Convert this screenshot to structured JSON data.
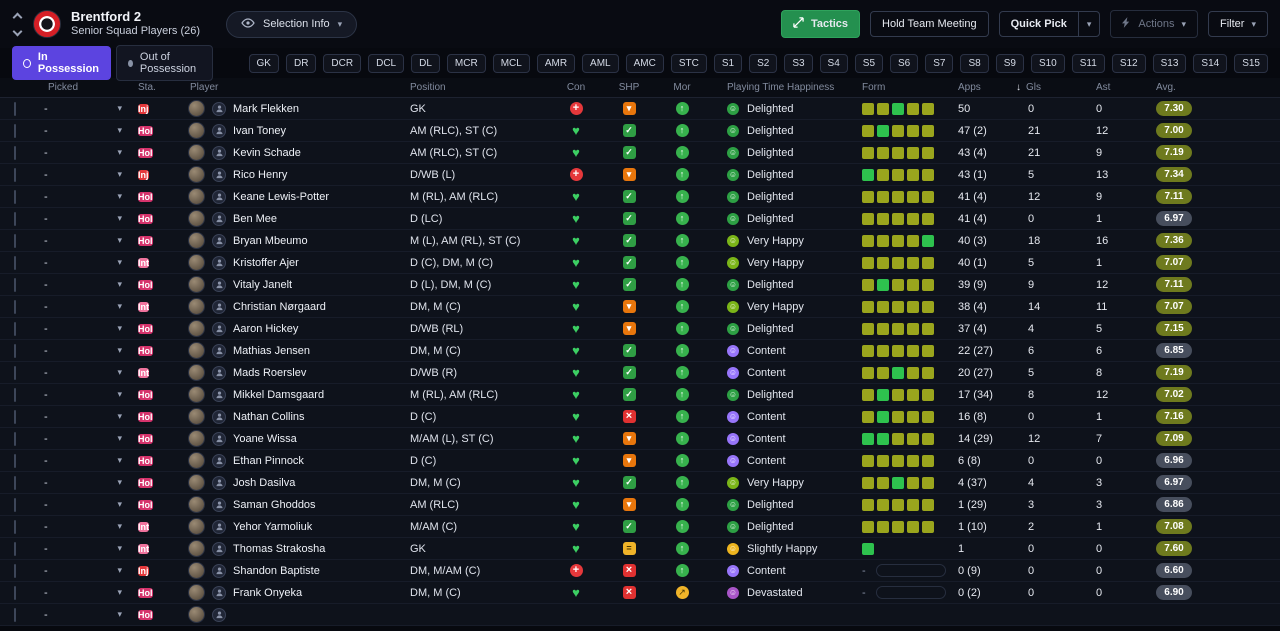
{
  "header": {
    "club": "Brentford 2",
    "subtitle": "Senior Squad Players (26)",
    "selection_info": "Selection Info",
    "tactics": "Tactics",
    "hold_team_meeting": "Hold Team Meeting",
    "quick_pick": "Quick Pick",
    "actions": "Actions",
    "filter": "Filter"
  },
  "tabs": [
    {
      "label": "In Possession",
      "active": true
    },
    {
      "label": "Out of Possession",
      "active": false
    }
  ],
  "position_filters": [
    "GK",
    "DR",
    "DCR",
    "DCL",
    "DL",
    "MCR",
    "MCL",
    "AMR",
    "AML",
    "AMC",
    "STC",
    "S1",
    "S2",
    "S3",
    "S4",
    "S5",
    "S6",
    "S7",
    "S8",
    "S9",
    "S10",
    "S11",
    "S12",
    "S13",
    "S14",
    "S15"
  ],
  "columns": [
    "Picked",
    "Sta.",
    "Player",
    "Position",
    "Con",
    "SHP",
    "Mor",
    "Playing Time Happiness",
    "Form",
    "Apps",
    "Gls",
    "Ast",
    "Avg."
  ],
  "sort": {
    "column": "Gls",
    "direction": "desc",
    "arrow": "↓"
  },
  "colors": {
    "accent_purple": "#5c44e0",
    "tactics_green": "#24904f",
    "status": {
      "Inj": "#e5383b",
      "Hol": "#d6336c",
      "Int": "#f0739d"
    },
    "happiness": {
      "Delighted": "#2da044",
      "Very Happy": "#7bb518",
      "Content": "#9775fa",
      "Slightly Happy": "#edb41f",
      "Devastated": "#a855c8"
    },
    "form": {
      "o": "#9aa51d",
      "g": "#2ec24e"
    },
    "avg_high": "#6e7a1e",
    "avg_low": "#474e5d"
  },
  "players": [
    {
      "picked": "-",
      "status": "Inj",
      "name": "Mark Flekken",
      "position": "GK",
      "con": "inj",
      "shp": "down",
      "mor": "up",
      "happiness": "Delighted",
      "form": [
        "o",
        "o",
        "g",
        "o",
        "o"
      ],
      "apps": "50",
      "gls": "0",
      "ast": "0",
      "avg": "7.30"
    },
    {
      "picked": "-",
      "status": "Hol",
      "name": "Ivan Toney",
      "position": "AM (RLC), ST (C)",
      "con": "ok",
      "shp": "check",
      "mor": "up",
      "happiness": "Delighted",
      "form": [
        "o",
        "g",
        "o",
        "o",
        "o"
      ],
      "apps": "47 (2)",
      "gls": "21",
      "ast": "12",
      "avg": "7.00"
    },
    {
      "picked": "-",
      "status": "Hol",
      "name": "Kevin Schade",
      "position": "AM (RLC), ST (C)",
      "con": "ok",
      "shp": "check",
      "mor": "up",
      "happiness": "Delighted",
      "form": [
        "o",
        "o",
        "o",
        "o",
        "o"
      ],
      "apps": "43 (4)",
      "gls": "21",
      "ast": "9",
      "avg": "7.19"
    },
    {
      "picked": "-",
      "status": "Inj",
      "name": "Rico Henry",
      "position": "D/WB (L)",
      "con": "inj",
      "shp": "down",
      "mor": "up",
      "happiness": "Delighted",
      "form": [
        "g",
        "o",
        "o",
        "o",
        "o"
      ],
      "apps": "43 (1)",
      "gls": "5",
      "ast": "13",
      "avg": "7.34"
    },
    {
      "picked": "-",
      "status": "Hol",
      "name": "Keane Lewis-Potter",
      "position": "M (RL), AM (RLC)",
      "con": "ok",
      "shp": "check",
      "mor": "up",
      "happiness": "Delighted",
      "form": [
        "o",
        "o",
        "o",
        "o",
        "o"
      ],
      "apps": "41 (4)",
      "gls": "12",
      "ast": "9",
      "avg": "7.11"
    },
    {
      "picked": "-",
      "status": "Hol",
      "name": "Ben Mee",
      "position": "D (LC)",
      "con": "ok",
      "shp": "check",
      "mor": "up",
      "happiness": "Delighted",
      "form": [
        "o",
        "o",
        "o",
        "o",
        "o"
      ],
      "apps": "41 (4)",
      "gls": "0",
      "ast": "1",
      "avg": "6.97"
    },
    {
      "picked": "-",
      "status": "Hol",
      "name": "Bryan Mbeumo",
      "position": "M (L), AM (RL), ST (C)",
      "con": "ok",
      "shp": "check",
      "mor": "up",
      "happiness": "Very Happy",
      "form": [
        "o",
        "o",
        "o",
        "o",
        "g"
      ],
      "apps": "40 (3)",
      "gls": "18",
      "ast": "16",
      "avg": "7.36"
    },
    {
      "picked": "-",
      "status": "Int",
      "name": "Kristoffer Ajer",
      "position": "D (C), DM, M (C)",
      "con": "ok",
      "shp": "check",
      "mor": "up",
      "happiness": "Very Happy",
      "form": [
        "o",
        "o",
        "o",
        "o",
        "o"
      ],
      "apps": "40 (1)",
      "gls": "5",
      "ast": "1",
      "avg": "7.07"
    },
    {
      "picked": "-",
      "status": "Hol",
      "name": "Vitaly Janelt",
      "position": "D (L), DM, M (C)",
      "con": "ok",
      "shp": "check",
      "mor": "up",
      "happiness": "Delighted",
      "form": [
        "o",
        "g",
        "o",
        "o",
        "o"
      ],
      "apps": "39 (9)",
      "gls": "9",
      "ast": "12",
      "avg": "7.11"
    },
    {
      "picked": "-",
      "status": "Int",
      "name": "Christian Nørgaard",
      "position": "DM, M (C)",
      "con": "ok",
      "shp": "down",
      "mor": "up",
      "happiness": "Very Happy",
      "form": [
        "o",
        "o",
        "o",
        "o",
        "o"
      ],
      "apps": "38 (4)",
      "gls": "14",
      "ast": "11",
      "avg": "7.07"
    },
    {
      "picked": "-",
      "status": "Hol",
      "name": "Aaron Hickey",
      "position": "D/WB (RL)",
      "con": "ok",
      "shp": "down",
      "mor": "up",
      "happiness": "Delighted",
      "form": [
        "o",
        "o",
        "o",
        "o",
        "o"
      ],
      "apps": "37 (4)",
      "gls": "4",
      "ast": "5",
      "avg": "7.15"
    },
    {
      "picked": "-",
      "status": "Hol",
      "name": "Mathias Jensen",
      "position": "DM, M (C)",
      "con": "ok",
      "shp": "check",
      "mor": "up",
      "happiness": "Content",
      "form": [
        "o",
        "o",
        "o",
        "o",
        "o"
      ],
      "apps": "22 (27)",
      "gls": "6",
      "ast": "6",
      "avg": "6.85"
    },
    {
      "picked": "-",
      "status": "Int",
      "name": "Mads Roerslev",
      "position": "D/WB (R)",
      "con": "ok",
      "shp": "check",
      "mor": "up",
      "happiness": "Content",
      "form": [
        "o",
        "o",
        "g",
        "o",
        "o"
      ],
      "apps": "20 (27)",
      "gls": "5",
      "ast": "8",
      "avg": "7.19"
    },
    {
      "picked": "-",
      "status": "Hol",
      "name": "Mikkel Damsgaard",
      "position": "M (RL), AM (RLC)",
      "con": "ok",
      "shp": "check",
      "mor": "up",
      "happiness": "Delighted",
      "form": [
        "o",
        "g",
        "o",
        "o",
        "o"
      ],
      "apps": "17 (34)",
      "gls": "8",
      "ast": "12",
      "avg": "7.02"
    },
    {
      "picked": "-",
      "status": "Hol",
      "name": "Nathan Collins",
      "position": "D (C)",
      "con": "ok",
      "shp": "x",
      "mor": "up",
      "happiness": "Content",
      "form": [
        "o",
        "g",
        "o",
        "o",
        "o"
      ],
      "apps": "16 (8)",
      "gls": "0",
      "ast": "1",
      "avg": "7.16"
    },
    {
      "picked": "-",
      "status": "Hol",
      "name": "Yoane Wissa",
      "position": "M/AM (L), ST (C)",
      "con": "ok",
      "shp": "down",
      "mor": "up",
      "happiness": "Content",
      "form": [
        "g",
        "g",
        "o",
        "o",
        "o"
      ],
      "apps": "14 (29)",
      "gls": "12",
      "ast": "7",
      "avg": "7.09"
    },
    {
      "picked": "-",
      "status": "Hol",
      "name": "Ethan Pinnock",
      "position": "D (C)",
      "con": "ok",
      "shp": "down",
      "mor": "up",
      "happiness": "Content",
      "form": [
        "o",
        "o",
        "o",
        "o",
        "o"
      ],
      "apps": "6 (8)",
      "gls": "0",
      "ast": "0",
      "avg": "6.96"
    },
    {
      "picked": "-",
      "status": "Hol",
      "name": "Josh Dasilva",
      "position": "DM, M (C)",
      "con": "ok",
      "shp": "check",
      "mor": "up",
      "happiness": "Very Happy",
      "form": [
        "o",
        "o",
        "g",
        "o",
        "o"
      ],
      "apps": "4 (37)",
      "gls": "4",
      "ast": "3",
      "avg": "6.97"
    },
    {
      "picked": "-",
      "status": "Hol",
      "name": "Saman Ghoddos",
      "position": "AM (RLC)",
      "con": "ok",
      "shp": "down",
      "mor": "up",
      "happiness": "Delighted",
      "form": [
        "o",
        "o",
        "o",
        "o",
        "o"
      ],
      "apps": "1 (29)",
      "gls": "3",
      "ast": "3",
      "avg": "6.86"
    },
    {
      "picked": "-",
      "status": "Int",
      "name": "Yehor Yarmoliuk",
      "position": "M/AM (C)",
      "con": "ok",
      "shp": "check",
      "mor": "up",
      "happiness": "Delighted",
      "form": [
        "o",
        "o",
        "o",
        "o",
        "o"
      ],
      "apps": "1 (10)",
      "gls": "2",
      "ast": "1",
      "avg": "7.08"
    },
    {
      "picked": "-",
      "status": "Int",
      "name": "Thomas Strakosha",
      "position": "GK",
      "con": "ok",
      "shp": "eq",
      "mor": "up",
      "happiness": "Slightly Happy",
      "form": [
        "g"
      ],
      "apps": "1",
      "gls": "0",
      "ast": "0",
      "avg": "7.60"
    },
    {
      "picked": "-",
      "status": "Inj",
      "name": "Shandon Baptiste",
      "position": "DM, M/AM (C)",
      "con": "inj",
      "shp": "x",
      "mor": "up",
      "happiness": "Content",
      "form": null,
      "apps": "0 (9)",
      "gls": "0",
      "ast": "0",
      "avg": "6.60"
    },
    {
      "picked": "-",
      "status": "Hol",
      "name": "Frank Onyeka",
      "position": "DM, M (C)",
      "con": "ok",
      "shp": "x",
      "mor": "diag",
      "happiness": "Devastated",
      "form": null,
      "apps": "0 (2)",
      "gls": "0",
      "ast": "0",
      "avg": "6.90"
    },
    {
      "picked": "-",
      "status": "Hol",
      "name": "",
      "position": "",
      "con": "",
      "shp": "",
      "mor": "",
      "happiness": "",
      "form": [],
      "apps": "",
      "gls": "",
      "ast": "",
      "avg": ""
    }
  ]
}
